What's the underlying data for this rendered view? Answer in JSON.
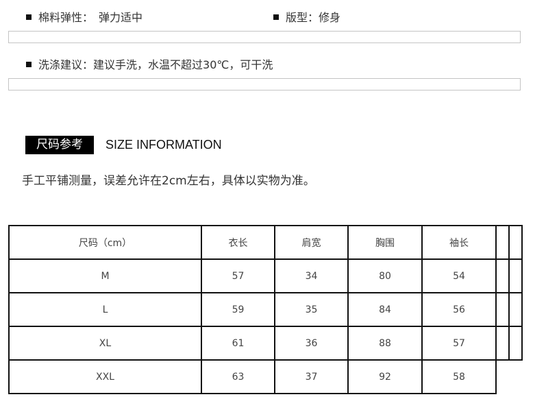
{
  "attributes": {
    "elasticity": {
      "label": "棉料弹性：",
      "value": "弹力适中"
    },
    "fit": {
      "label": "版型：",
      "value": "修身"
    },
    "washing": {
      "label": "洗涤建议：",
      "value": "建议手洗，水温不超过30℃，可干洗"
    }
  },
  "size_section": {
    "tag": "尺码参考",
    "title": "SIZE INFORMATION",
    "note": "手工平铺测量，误差允许在2cm左右，具体以实物为准。"
  },
  "size_table": {
    "headers": [
      "尺码（cm）",
      "衣长",
      "肩宽",
      "胸围",
      "袖长"
    ],
    "rows": [
      [
        "M",
        "57",
        "34",
        "80",
        "54"
      ],
      [
        "L",
        "59",
        "35",
        "84",
        "56"
      ],
      [
        "XL",
        "61",
        "36",
        "88",
        "57"
      ],
      [
        "XXL",
        "63",
        "37",
        "92",
        "58"
      ]
    ]
  }
}
